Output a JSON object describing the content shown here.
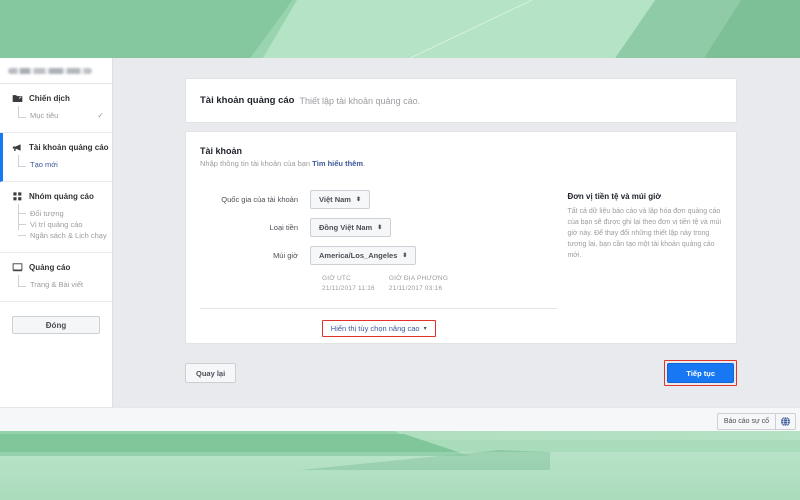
{
  "sidebar": {
    "account_pill": "",
    "groups": [
      {
        "title": "Chiến dịch",
        "icon": "campaign-folder-icon",
        "active": false,
        "items": [
          {
            "label": "Mục tiêu",
            "check": "✓"
          }
        ]
      },
      {
        "title": "Tài khoản quảng cáo",
        "icon": "megaphone-icon",
        "active": true,
        "items": [
          {
            "label": "Tạo mới"
          }
        ]
      },
      {
        "title": "Nhóm quảng cáo",
        "icon": "grid-icon",
        "active": false,
        "items": [
          {
            "label": "Đối tượng"
          },
          {
            "label": "Vị trí quảng cáo"
          },
          {
            "label": "Ngân sách & Lịch chạy"
          }
        ]
      },
      {
        "title": "Quảng cáo",
        "icon": "monitor-icon",
        "active": false,
        "items": [
          {
            "label": "Trang & Bài viết"
          }
        ]
      }
    ],
    "close_label": "Đóng"
  },
  "header": {
    "title": "Tài khoản quảng cáo",
    "subtitle": "Thiết lập tài khoản quảng cáo."
  },
  "section": {
    "title": "Tài khoản",
    "subtitle_prefix": "Nhập thông tin tài khoản của bạn ",
    "subtitle_link": "Tìm hiểu thêm",
    "subtitle_suffix": "."
  },
  "form": {
    "country": {
      "label": "Quốc gia của tài khoản",
      "value": "Việt Nam",
      "caret": "⬍"
    },
    "currency": {
      "label": "Loại tiền",
      "value": "Đồng Việt Nam",
      "caret": "⬍"
    },
    "timezone": {
      "label": "Múi giờ",
      "value": "America/Los_Angeles",
      "caret": "⬍"
    },
    "times": [
      {
        "label": "GIỜ UTC",
        "value": "21/11/2017 11:16"
      },
      {
        "label": "GIỜ ĐỊA PHƯƠNG",
        "value": "21/11/2017 03:16"
      }
    ],
    "advanced_toggle": {
      "label": "Hiển thị tùy chọn nâng cao",
      "caret": "▾",
      "highlight_color": "#e0342a"
    }
  },
  "info_panel": {
    "title": "Đơn vị tiền tệ và múi giờ",
    "body": "Tất cả dữ liệu báo cáo và lập hóa đơn quảng cáo của bạn sẽ được ghi lại theo đơn vị tiền tệ và múi giờ này. Để thay đổi những thiết lập này trong tương lai, bạn cần tạo một tài khoản quảng cáo mới."
  },
  "footer": {
    "back_label": "Quay lại",
    "next_label": "Tiếp tục",
    "next_color": "#1877f2",
    "next_highlight_color": "#e0342a"
  },
  "report_bar": {
    "label": "Báo cáo sự cố",
    "globe_icon": "globe-icon"
  }
}
